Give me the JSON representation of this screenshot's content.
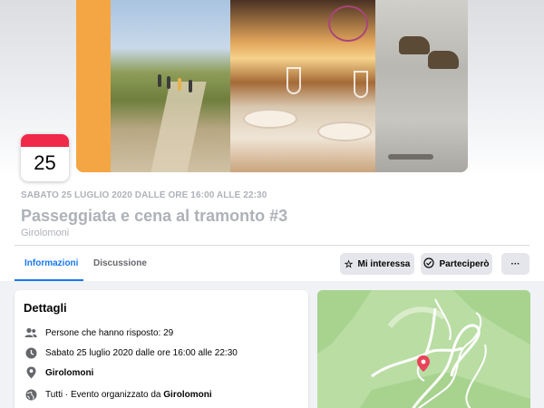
{
  "event": {
    "date_day": "25",
    "datetime_caps": "SABATO 25 LUGLIO 2020 DALLE ORE 16:00 ALLE 22:30",
    "title": "Passeggiata e cena al tramonto #3",
    "location": "Girolomoni"
  },
  "tabs": [
    {
      "label": "Informazioni",
      "active": true
    },
    {
      "label": "Discussione",
      "active": false
    }
  ],
  "actions": {
    "interested": "Mi interessa",
    "going": "Parteciperò",
    "more": "···"
  },
  "details": {
    "heading": "Dettagli",
    "responded": "Persone che hanno risposto: 29",
    "datetime": "Sabato 25 luglio 2020 dalle ore 16:00 alle 22:30",
    "location": "Girolomoni",
    "privacy_prefix": "Tutti · Evento organizzato da ",
    "organizer": "Girolomoni"
  },
  "icons": {
    "people": "people-icon",
    "clock": "clock-icon",
    "pin": "location-pin-icon",
    "globe": "globe-icon",
    "star": "star-icon",
    "check": "check-circle-icon",
    "more": "more-icon"
  },
  "colors": {
    "accent": "#1877f2",
    "calendar_red": "#f02849",
    "map_pin": "#e8445a"
  }
}
